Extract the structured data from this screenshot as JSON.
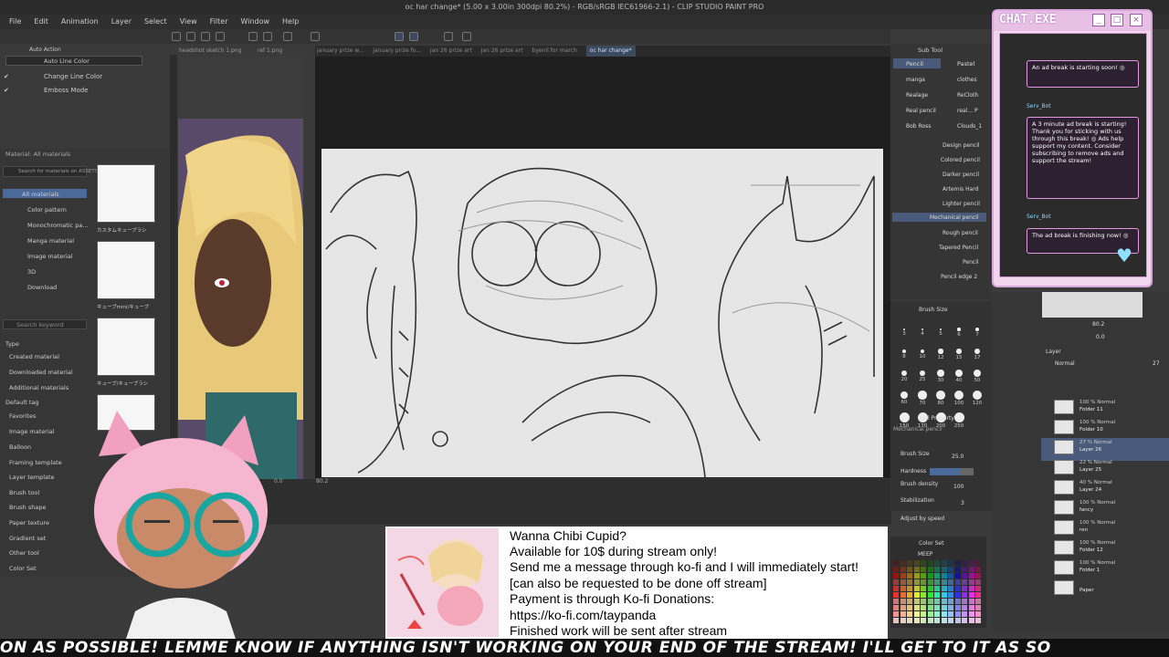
{
  "window": {
    "title": "oc har change* (5.00 x 3.00in 300dpi 80.2%) - RGB/sRGB IEC61966-2.1) - CLIP STUDIO PAINT PRO"
  },
  "menu": [
    "File",
    "Edit",
    "Animation",
    "Layer",
    "Select",
    "View",
    "Filter",
    "Window",
    "Help"
  ],
  "doc_tabs": [
    {
      "label": "january prize w...",
      "active": false
    },
    {
      "label": "january prize fo...",
      "active": false
    },
    {
      "label": "jan 26 prize art",
      "active": false
    },
    {
      "label": "jan 26 prize art",
      "active": false
    },
    {
      "label": "byenil for march",
      "active": false
    },
    {
      "label": "oc har change*",
      "active": true
    }
  ],
  "left_panel": {
    "tab1": "Auto Action",
    "auto_line_color": "Auto Line Color",
    "rows": [
      "Change Line Color",
      "Emboss Mode"
    ]
  },
  "ref_tabs": [
    "headshot sketch 1.png",
    "ref 1.png"
  ],
  "materials": {
    "header": "Material: All materials",
    "search": "Search for materials on ASSETS",
    "tree": [
      "All materials",
      "Color pattern",
      "Monochromatic pa...",
      "Manga material",
      "Image material",
      "3D",
      "Download"
    ],
    "keyword": "Search keyword",
    "types_label": "Type",
    "types": [
      "Created material",
      "Downloaded material",
      "Additional materials"
    ],
    "tags_label": "Default tag",
    "tags": [
      "Favorites",
      "Image material",
      "Balloon",
      "Framing template",
      "Layer template",
      "Brush tool",
      "Brush shape",
      "Paper texture",
      "Gradient set",
      "Other tool",
      "Color Set"
    ],
    "thumb_captions": [
      "カスタムキューブラシ",
      "キューブmini/キューブ",
      "キューブ/キューブラシ"
    ]
  },
  "subtool": {
    "header": "Sub Tool",
    "tabs": [
      "Pencil",
      "Pastel"
    ],
    "sets": [
      "manga",
      "clothes",
      "Realage",
      "ReCloth",
      "Real pencil",
      "real... P",
      "Bob Ross",
      "Clouds_1"
    ],
    "brushes": [
      "Design pencil",
      "Colored pencil",
      "Darker pencil",
      "Artemis Hard",
      "Lighter pencil",
      "Mechanical pencil",
      "Rough pencil",
      "Tapered Pencil",
      "Pencil",
      "Pencil edge 2"
    ]
  },
  "brush_size": {
    "header": "Brush Size",
    "sizes": [
      "3",
      "4",
      "5",
      "6",
      "7",
      "8",
      "10",
      "12",
      "15",
      "17",
      "20",
      "25",
      "30",
      "40",
      "50",
      "60",
      "70",
      "80",
      "100",
      "120",
      "150",
      "170",
      "200",
      "250"
    ]
  },
  "tool_property": {
    "header": "Tool Property",
    "tool_name": "Mechanical pencil",
    "brush_size_label": "Brush Size",
    "brush_size_value": "25.0",
    "hardness_label": "Hardness",
    "density_label": "Brush density",
    "density_value": "100",
    "stabilization_label": "Stabilization",
    "stabilization_value": "3",
    "adjust": "Adjust by speed"
  },
  "colorset": {
    "header": "Color Set",
    "name": "MEEP"
  },
  "layers": {
    "header": "Layer",
    "blend": "Normal",
    "opacity": "27",
    "items": [
      {
        "pct": "100 % Normal",
        "name": "Folder 11"
      },
      {
        "pct": "100 % Normal",
        "name": "Folder 10"
      },
      {
        "pct": "27 % Normal",
        "name": "Layer 26"
      },
      {
        "pct": "22 % Normal",
        "name": "Layer 25"
      },
      {
        "pct": "40 % Normal",
        "name": "Layer 24"
      },
      {
        "pct": "100 % Normal",
        "name": "fancy"
      },
      {
        "pct": "100 % Normal",
        "name": "ren"
      },
      {
        "pct": "100 % Normal",
        "name": "Folder 12"
      },
      {
        "pct": "100 % Normal",
        "name": "Folder 1"
      },
      {
        "pct": "",
        "name": "Paper"
      }
    ]
  },
  "navigator": {
    "zoom": "80.2",
    "angle": "0.0"
  },
  "canvas_status": {
    "zoom": "80.2",
    "angle": "0.0"
  },
  "chat": {
    "title": "CHAT.EXE",
    "window_buttons": [
      "_",
      "□",
      "×"
    ],
    "messages": [
      {
        "text": "An ad break is starting soon! ◎"
      },
      {
        "user": "Serv_Bot",
        "text": "A 3 minute ad break is starting! Thank you for sticking with us through this break! ◎ Ads help support my content. Consider subscribing to remove ads and support the stream!"
      },
      {
        "user": "Serv_Bot",
        "text": "The ad break is finishing now! ◎"
      }
    ]
  },
  "promo": {
    "lines": [
      "Wanna Chibi Cupid?",
      "Available for 10$ during stream only!",
      "Send me a message through ko-fi and I will immediately start!",
      "[can also be requested to be done off stream]",
      "Payment is through Ko-fi Donations:",
      "https://ko-fi.com/taypanda",
      "Finished work will be sent after stream"
    ]
  },
  "ticker": "ON AS POSSIBLE!  LEMME KNOW IF ANYTHING ISN'T WORKING ON YOUR END OF THE STREAM! I'LL GET TO IT AS SO",
  "colors": {
    "accent": "#3d4a5e",
    "chat_border": "#d8a6dd",
    "bubble_border": "#e39ae0"
  }
}
